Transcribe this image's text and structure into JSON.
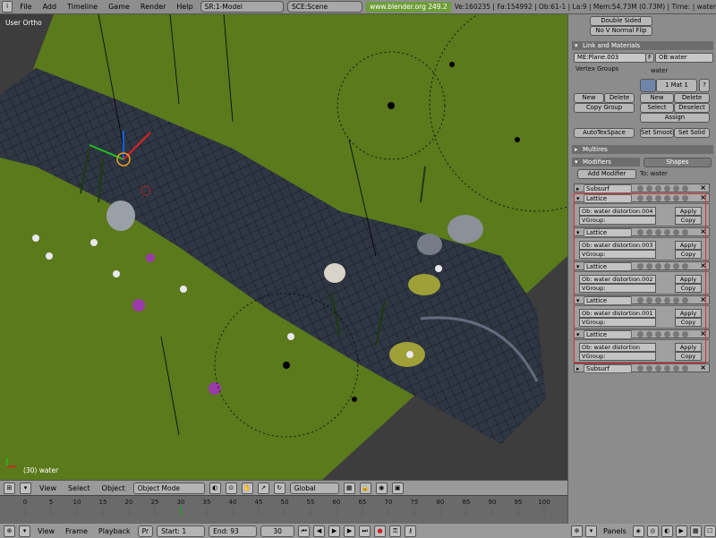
{
  "top": {
    "menus": [
      "File",
      "Add",
      "Timeline",
      "Game",
      "Render",
      "Help"
    ],
    "screen": "SR:1-Model",
    "scene": "SCE:Scene",
    "url": "www.blender.org 249.2",
    "stats": "Ve:160235 | Fa:154992 | Ob:61-1 | La:9 | Mem:54.73M (0.73M) | Time: | water"
  },
  "viewport": {
    "view_label": "User Ortho",
    "object_label": "(30) water"
  },
  "header3d": {
    "menus": [
      "View",
      "Select",
      "Object"
    ],
    "mode": "Object Mode",
    "orientation": "Global"
  },
  "timeline": {
    "ticks": [
      "0",
      "5",
      "10",
      "15",
      "20",
      "25",
      "30",
      "35",
      "40",
      "45",
      "50",
      "55",
      "60",
      "65",
      "70",
      "75",
      "80",
      "85",
      "90",
      "95",
      "100"
    ],
    "current_frame": "30",
    "menus": [
      "View",
      "Frame",
      "Playback"
    ],
    "pr": "Pr",
    "start": "Start: 1",
    "end": "End: 93"
  },
  "panel": {
    "double_sided": "Double Sided",
    "no_v_normal_flip": "No V Normal Flip",
    "link_section": "Link and Materials",
    "me_field": "ME:Plane.003",
    "f_label": "F",
    "ob_field": "OB:water",
    "vertex_groups": "Vertex Groups",
    "material_name": "water",
    "mat_counter": "1 Mat 1",
    "question": "?",
    "new": "New",
    "delete": "Delete",
    "copy_group": "Copy Group",
    "select": "Select",
    "deselect": "Deselect",
    "assign": "Assign",
    "autotexspace": "AutoTexSpace",
    "set_smooth": "Set Smooth",
    "set_solid": "Set Solid",
    "multires": "Multires",
    "modifiers_tab": "Modifiers",
    "shapes_tab": "Shapes",
    "add_modifier": "Add Modifier",
    "to_label": "To: water",
    "apply": "Apply",
    "copy": "Copy",
    "vgroup": "VGroup:",
    "modifiers": [
      {
        "name": "Subsurf",
        "collapsed": true
      },
      {
        "name": "Lattice",
        "ob": "Ob: water distortion.004"
      },
      {
        "name": "Lattice",
        "ob": "Ob: water distortion.003"
      },
      {
        "name": "Lattice",
        "ob": "Ob: water distortion.002"
      },
      {
        "name": "Lattice",
        "ob": "Ob: water distortion.001"
      },
      {
        "name": "Lattice",
        "ob": "Ob: water distortion"
      },
      {
        "name": "Subsurf",
        "collapsed": true
      }
    ]
  },
  "panels_bar": {
    "label": "Panels"
  },
  "colors": {
    "grass": "#5b7a1e",
    "water": "#2d3442",
    "highlight": "#d83030"
  }
}
